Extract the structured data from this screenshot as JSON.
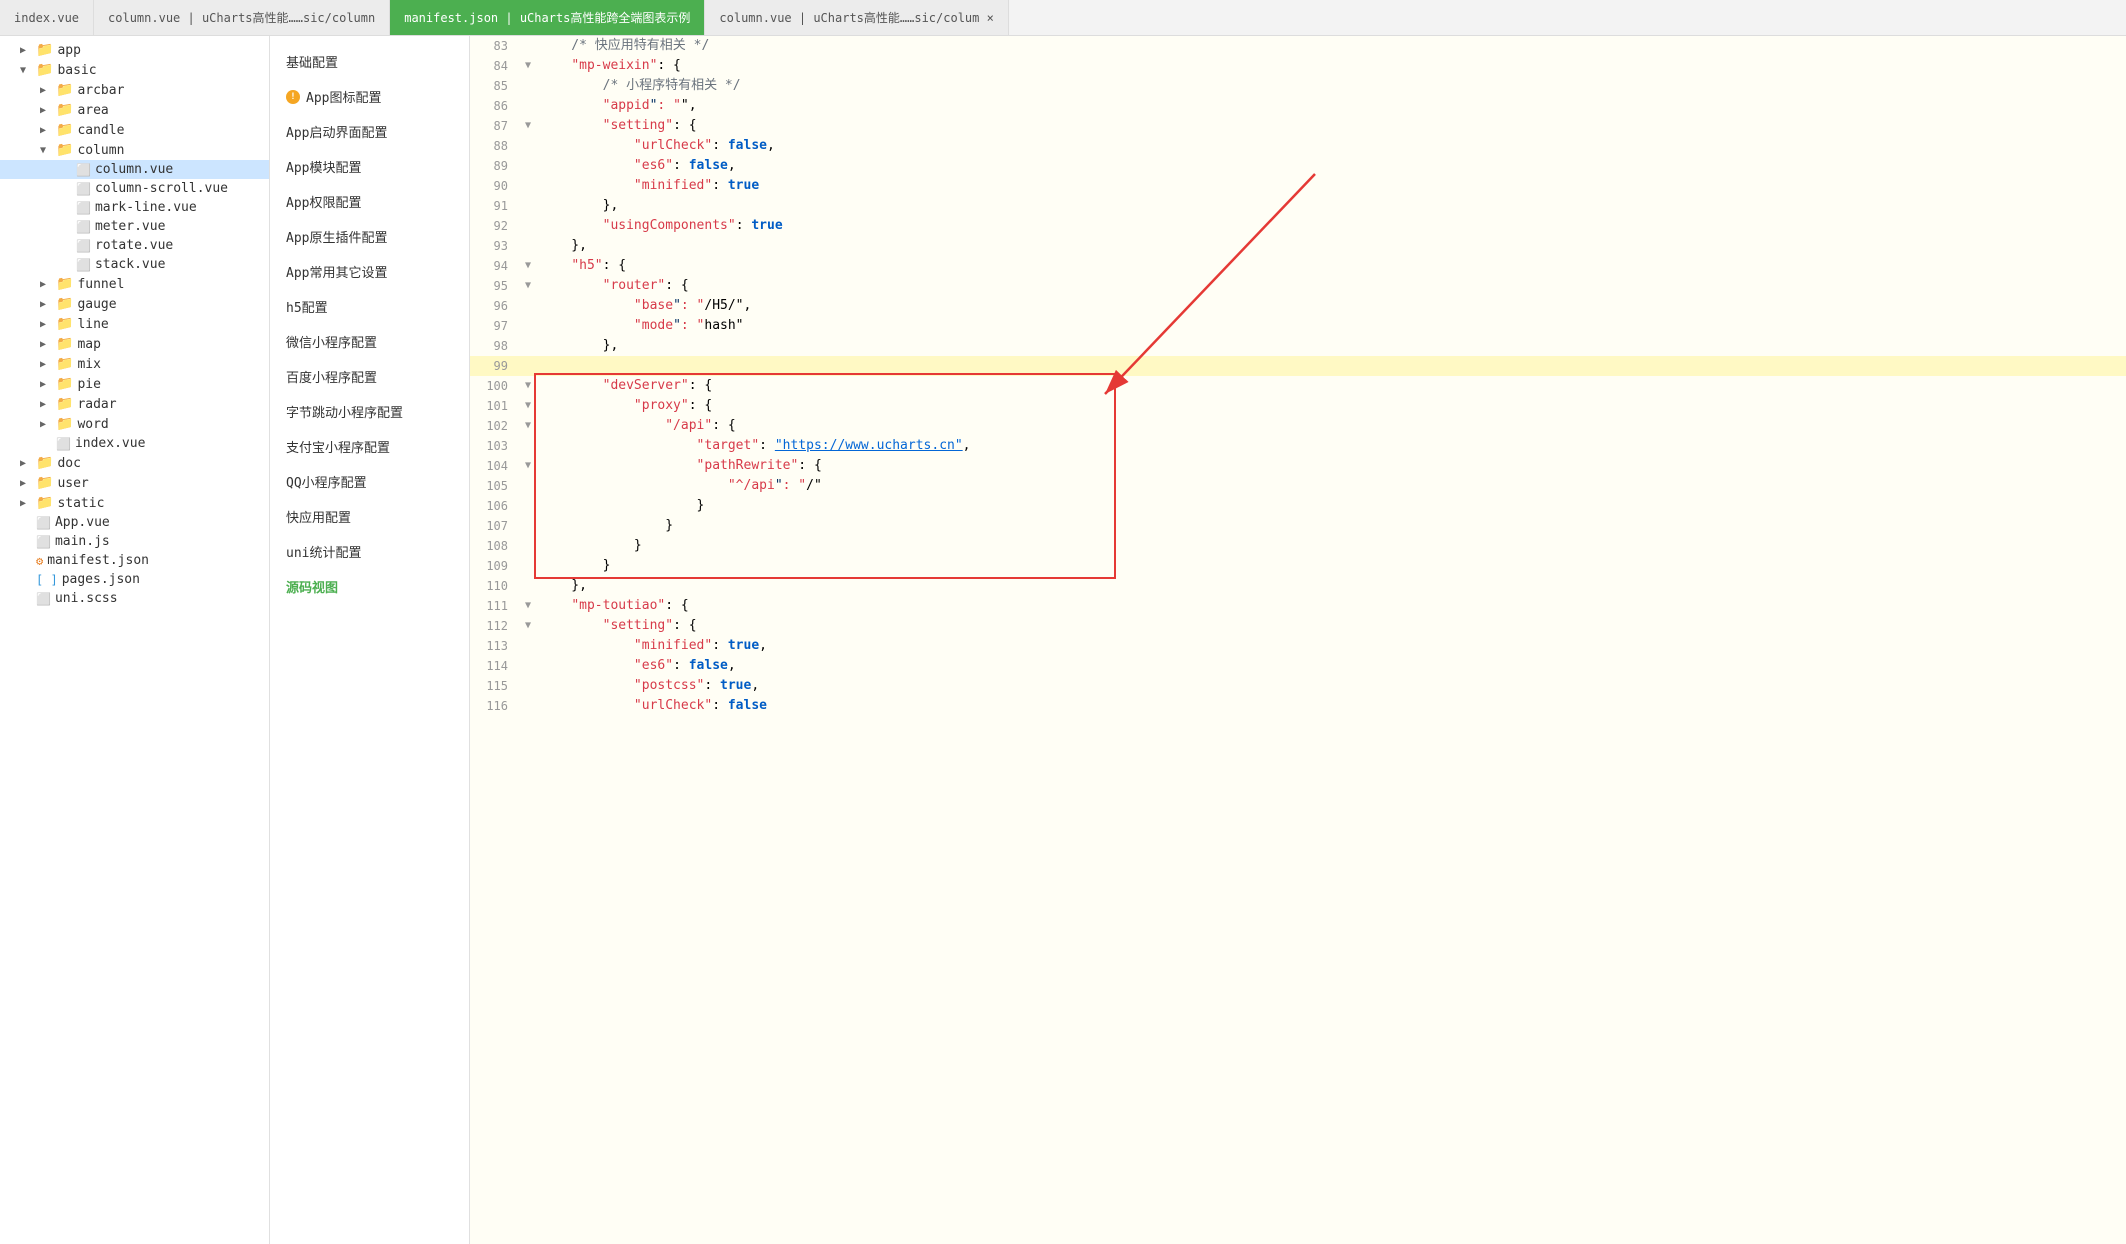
{
  "tabs": [
    {
      "id": "index-vue",
      "label": "index.vue",
      "active": false
    },
    {
      "id": "column-vue",
      "label": "column.vue | uCharts高性能……sic/column",
      "active": false
    },
    {
      "id": "manifest-json",
      "label": "manifest.json | uCharts高性能跨全端图表示例",
      "active": true
    },
    {
      "id": "column-vue2",
      "label": "column.vue | uCharts高性能……sic/colum ×",
      "active": false
    }
  ],
  "sidebar": {
    "items": [
      {
        "id": "app",
        "label": "app",
        "type": "folder",
        "indent": 1,
        "collapsed": true
      },
      {
        "id": "basic",
        "label": "basic",
        "type": "folder",
        "indent": 1,
        "collapsed": false
      },
      {
        "id": "arcbar",
        "label": "arcbar",
        "type": "folder",
        "indent": 2,
        "collapsed": true
      },
      {
        "id": "area",
        "label": "area",
        "type": "folder",
        "indent": 2,
        "collapsed": true
      },
      {
        "id": "candle",
        "label": "candle",
        "type": "folder",
        "indent": 2,
        "collapsed": true
      },
      {
        "id": "column",
        "label": "column",
        "type": "folder",
        "indent": 2,
        "collapsed": false
      },
      {
        "id": "column-vue",
        "label": "column.vue",
        "type": "vue",
        "indent": 3,
        "selected": true
      },
      {
        "id": "column-scroll-vue",
        "label": "column-scroll.vue",
        "type": "vue",
        "indent": 3
      },
      {
        "id": "mark-line-vue",
        "label": "mark-line.vue",
        "type": "vue",
        "indent": 3
      },
      {
        "id": "meter-vue",
        "label": "meter.vue",
        "type": "vue",
        "indent": 3
      },
      {
        "id": "rotate-vue",
        "label": "rotate.vue",
        "type": "vue",
        "indent": 3
      },
      {
        "id": "stack-vue",
        "label": "stack.vue",
        "type": "vue",
        "indent": 3
      },
      {
        "id": "funnel",
        "label": "funnel",
        "type": "folder",
        "indent": 2,
        "collapsed": true
      },
      {
        "id": "gauge",
        "label": "gauge",
        "type": "folder",
        "indent": 2,
        "collapsed": true
      },
      {
        "id": "line",
        "label": "line",
        "type": "folder",
        "indent": 2,
        "collapsed": true
      },
      {
        "id": "map",
        "label": "map",
        "type": "folder",
        "indent": 2,
        "collapsed": true
      },
      {
        "id": "mix",
        "label": "mix",
        "type": "folder",
        "indent": 2,
        "collapsed": true
      },
      {
        "id": "pie",
        "label": "pie",
        "type": "folder",
        "indent": 2,
        "collapsed": true
      },
      {
        "id": "radar",
        "label": "radar",
        "type": "folder",
        "indent": 2,
        "collapsed": true
      },
      {
        "id": "word",
        "label": "word",
        "type": "folder",
        "indent": 2,
        "collapsed": true
      },
      {
        "id": "index-vue2",
        "label": "index.vue",
        "type": "vue",
        "indent": 2
      },
      {
        "id": "doc",
        "label": "doc",
        "type": "folder",
        "indent": 1,
        "collapsed": true
      },
      {
        "id": "user",
        "label": "user",
        "type": "folder",
        "indent": 1,
        "collapsed": true
      },
      {
        "id": "static",
        "label": "static",
        "type": "folder",
        "indent": 1,
        "collapsed": true
      },
      {
        "id": "App-vue",
        "label": "App.vue",
        "type": "vue",
        "indent": 1
      },
      {
        "id": "main-js",
        "label": "main.js",
        "type": "js",
        "indent": 1
      },
      {
        "id": "manifest-json",
        "label": "manifest.json",
        "type": "json",
        "indent": 1
      },
      {
        "id": "pages-json",
        "label": "pages.json",
        "type": "json-bracket",
        "indent": 1
      },
      {
        "id": "uni-scss",
        "label": "uni.scss",
        "type": "scss",
        "indent": 1
      }
    ]
  },
  "config_panel": {
    "items": [
      {
        "id": "basic-config",
        "label": "基础配置",
        "warning": false
      },
      {
        "id": "app-icon-config",
        "label": "App图标配置",
        "warning": true
      },
      {
        "id": "app-launch-config",
        "label": "App启动界面配置",
        "warning": false
      },
      {
        "id": "app-module-config",
        "label": "App模块配置",
        "warning": false
      },
      {
        "id": "app-permission-config",
        "label": "App权限配置",
        "warning": false
      },
      {
        "id": "app-plugin-config",
        "label": "App原生插件配置",
        "warning": false
      },
      {
        "id": "app-other-config",
        "label": "App常用其它设置",
        "warning": false
      },
      {
        "id": "h5-config",
        "label": "h5配置",
        "warning": false
      },
      {
        "id": "weixin-miniprogram-config",
        "label": "微信小程序配置",
        "warning": false
      },
      {
        "id": "baidu-miniprogram-config",
        "label": "百度小程序配置",
        "warning": false
      },
      {
        "id": "bytedance-miniprogram-config",
        "label": "字节跳动小程序配置",
        "warning": false
      },
      {
        "id": "alipay-miniprogram-config",
        "label": "支付宝小程序配置",
        "warning": false
      },
      {
        "id": "qq-miniprogram-config",
        "label": "QQ小程序配置",
        "warning": false
      },
      {
        "id": "quick-app-config",
        "label": "快应用配置",
        "warning": false
      },
      {
        "id": "uni-statistics-config",
        "label": "uni统计配置",
        "warning": false
      },
      {
        "id": "source-view",
        "label": "源码视图",
        "warning": false,
        "isSource": true
      }
    ]
  },
  "editor": {
    "lines": [
      {
        "num": 83,
        "fold": "",
        "content": "    /* 快应用特有相关 */",
        "class": "c-comment"
      },
      {
        "num": 84,
        "fold": "▼",
        "content": "    \"mp-weixin\": {",
        "key": "mp-weixin"
      },
      {
        "num": 85,
        "fold": "",
        "content": "        /* 小程序特有相关 */",
        "class": "c-comment"
      },
      {
        "num": 86,
        "fold": "",
        "content": "        \"appid\": \"\",",
        "raw": true
      },
      {
        "num": 87,
        "fold": "▼",
        "content": "        \"setting\": {",
        "raw": true
      },
      {
        "num": 88,
        "fold": "",
        "content": "            \"urlCheck\": false,",
        "raw": true
      },
      {
        "num": 89,
        "fold": "",
        "content": "            \"es6\": false,",
        "raw": true
      },
      {
        "num": 90,
        "fold": "",
        "content": "            \"minified\": true",
        "raw": true
      },
      {
        "num": 91,
        "fold": "",
        "content": "        },",
        "raw": true
      },
      {
        "num": 92,
        "fold": "",
        "content": "        \"usingComponents\": true",
        "raw": true
      },
      {
        "num": 93,
        "fold": "",
        "content": "    },",
        "raw": true
      },
      {
        "num": 94,
        "fold": "▼",
        "content": "    \"h5\": {",
        "raw": true
      },
      {
        "num": 95,
        "fold": "▼",
        "content": "        \"router\": {",
        "raw": true
      },
      {
        "num": 96,
        "fold": "",
        "content": "            \"base\": \"/H5/\",",
        "raw": true
      },
      {
        "num": 97,
        "fold": "",
        "content": "            \"mode\": \"hash\"",
        "raw": true
      },
      {
        "num": 98,
        "fold": "",
        "content": "        },",
        "raw": true
      },
      {
        "num": 99,
        "fold": "",
        "content": "        ",
        "raw": true,
        "highlighted": true
      },
      {
        "num": 100,
        "fold": "▼",
        "content": "        \"devServer\": {",
        "raw": true,
        "inBox": true
      },
      {
        "num": 101,
        "fold": "▼",
        "content": "            \"proxy\": {",
        "raw": true,
        "inBox": true
      },
      {
        "num": 102,
        "fold": "▼",
        "content": "                \"/api\": {",
        "raw": true,
        "inBox": true
      },
      {
        "num": 103,
        "fold": "",
        "content": "                    \"target\": \"https://www.ucharts.cn\",",
        "raw": true,
        "inBox": true
      },
      {
        "num": 104,
        "fold": "▼",
        "content": "                    \"pathRewrite\": {",
        "raw": true,
        "inBox": true
      },
      {
        "num": 105,
        "fold": "",
        "content": "                        \"^/api\": \"/\"",
        "raw": true,
        "inBox": true
      },
      {
        "num": 106,
        "fold": "",
        "content": "                    }",
        "raw": true,
        "inBox": true
      },
      {
        "num": 107,
        "fold": "",
        "content": "                }",
        "raw": true,
        "inBox": true
      },
      {
        "num": 108,
        "fold": "",
        "content": "            }",
        "raw": true,
        "inBox": true
      },
      {
        "num": 109,
        "fold": "",
        "content": "        }",
        "raw": true,
        "inBox": true
      },
      {
        "num": 110,
        "fold": "",
        "content": "    },",
        "raw": true
      },
      {
        "num": 111,
        "fold": "▼",
        "content": "    \"mp-toutiao\": {",
        "raw": true
      },
      {
        "num": 112,
        "fold": "▼",
        "content": "        \"setting\": {",
        "raw": true
      },
      {
        "num": 113,
        "fold": "",
        "content": "            \"minified\": true,",
        "raw": true
      },
      {
        "num": 114,
        "fold": "",
        "content": "            \"es6\": false,",
        "raw": true
      },
      {
        "num": 115,
        "fold": "",
        "content": "            \"postcss\": true,",
        "raw": true
      },
      {
        "num": 116,
        "fold": "",
        "content": "            \"urlCheck\": false",
        "raw": true
      }
    ]
  }
}
